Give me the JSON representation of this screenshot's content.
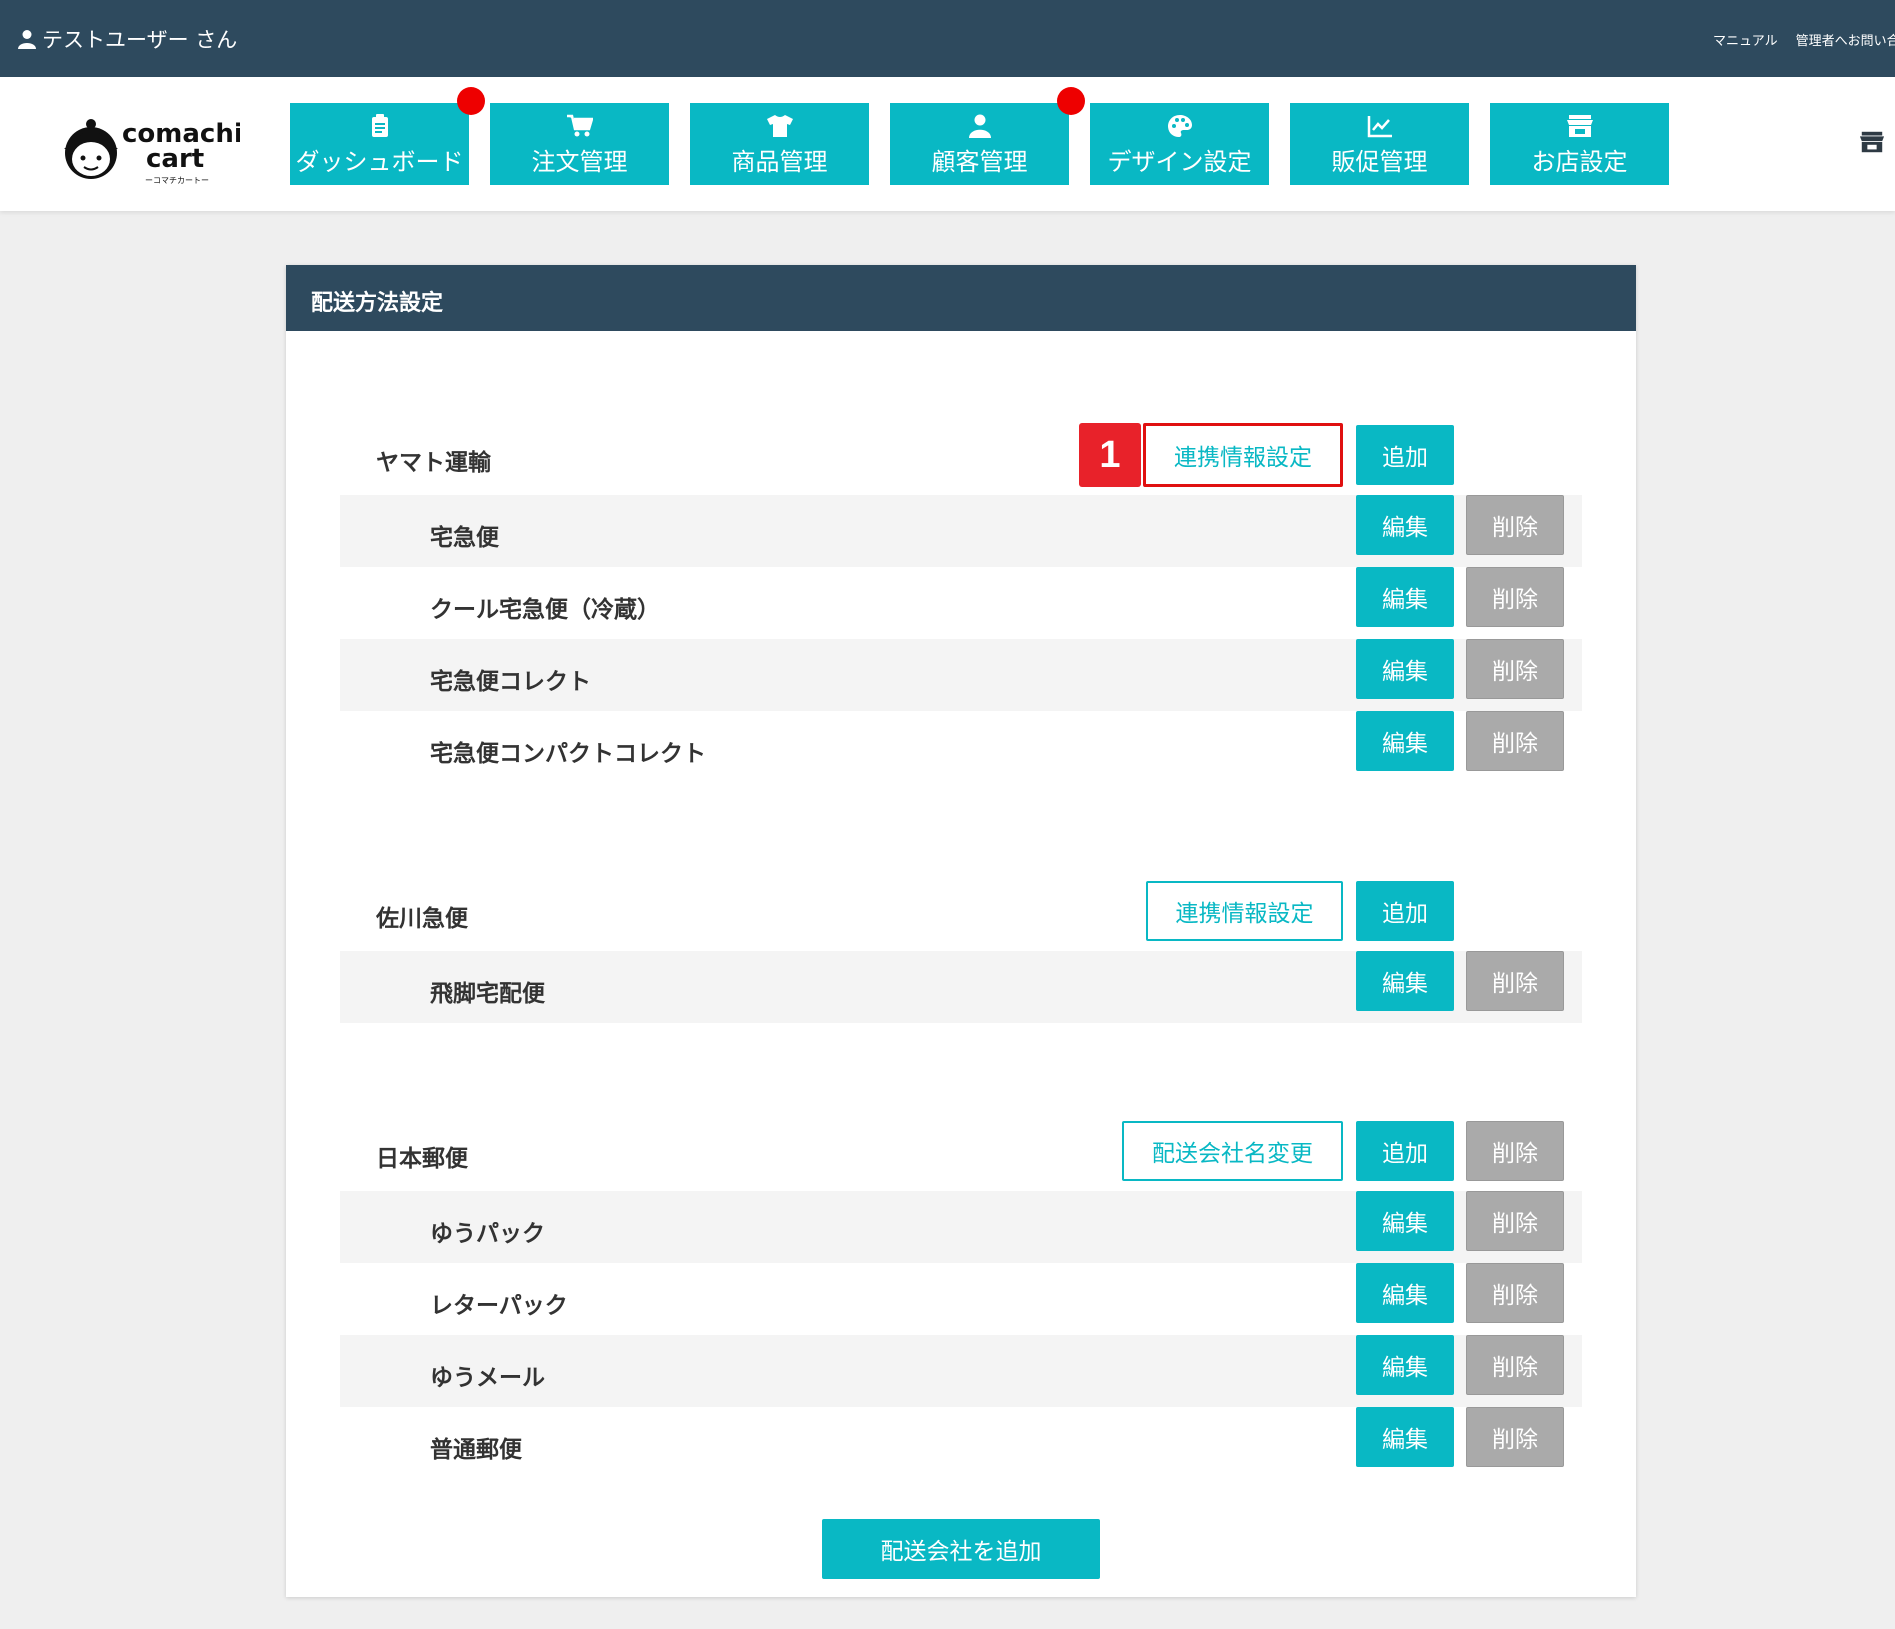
{
  "topbar": {
    "user": "テストユーザー さん",
    "manual": "マニュアル",
    "contact": "管理者へお問い合わせ"
  },
  "logo": {
    "line1": "comachi",
    "line2": "cart",
    "sub": "ーコマチカートー"
  },
  "nav": [
    {
      "label": "ダッシュボード",
      "icon": "clipboard-icon",
      "badge": true
    },
    {
      "label": "注文管理",
      "icon": "cart-icon",
      "badge": false
    },
    {
      "label": "商品管理",
      "icon": "shirt-icon",
      "badge": false
    },
    {
      "label": "顧客管理",
      "icon": "user-icon",
      "badge": true
    },
    {
      "label": "デザイン設定",
      "icon": "palette-icon",
      "badge": false
    },
    {
      "label": "販促管理",
      "icon": "chart-icon",
      "badge": false
    },
    {
      "label": "お店設定",
      "icon": "store-icon",
      "badge": false
    }
  ],
  "panel": {
    "title": "配送方法設定"
  },
  "labels": {
    "link_settings": "連携情報設定",
    "add": "追加",
    "edit": "編集",
    "delete": "削除",
    "rename": "配送会社名変更",
    "add_company": "配送会社を追加",
    "marker": "1"
  },
  "companies": [
    {
      "name": "ヤマト運輸",
      "services": [
        "宅急便",
        "クール宅急便（冷蔵）",
        "宅急便コレクト",
        "宅急便コンパクトコレクト"
      ]
    },
    {
      "name": "佐川急便",
      "services": [
        "飛脚宅配便"
      ]
    },
    {
      "name": "日本郵便",
      "services": [
        "ゆうパック",
        "レターパック",
        "ゆうメール",
        "普通郵便"
      ]
    }
  ],
  "colors": {
    "accent": "#09b8c4",
    "dark": "#2e4a5e",
    "alert": "#e01010"
  }
}
